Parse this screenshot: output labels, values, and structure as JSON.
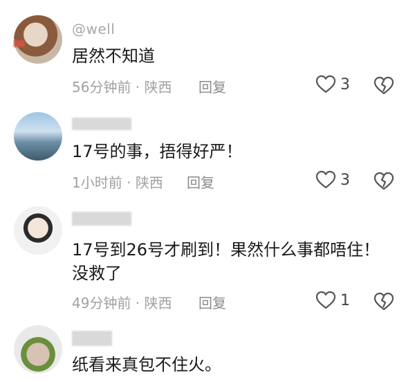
{
  "comments": [
    {
      "username": "@well",
      "text": "居然不知道",
      "time": "56分钟前",
      "location": "陕西",
      "reply_label": "回复",
      "likes": "3"
    },
    {
      "username": "",
      "text": "17号的事，捂得好严！",
      "time": "1小时前",
      "location": "陕西",
      "reply_label": "回复",
      "likes": "3"
    },
    {
      "username": "",
      "text_line1": "17号到26号才刷到！果然什么事都唔住！",
      "text_line2": "没救了",
      "time": "49分钟前",
      "location": "陕西",
      "reply_label": "回复",
      "likes": "1"
    },
    {
      "username": "",
      "text": "纸看来真包不住火。"
    }
  ],
  "separator": " · ",
  "icons": {
    "like": "heart-outline-icon",
    "dislike": "broken-heart-icon"
  }
}
